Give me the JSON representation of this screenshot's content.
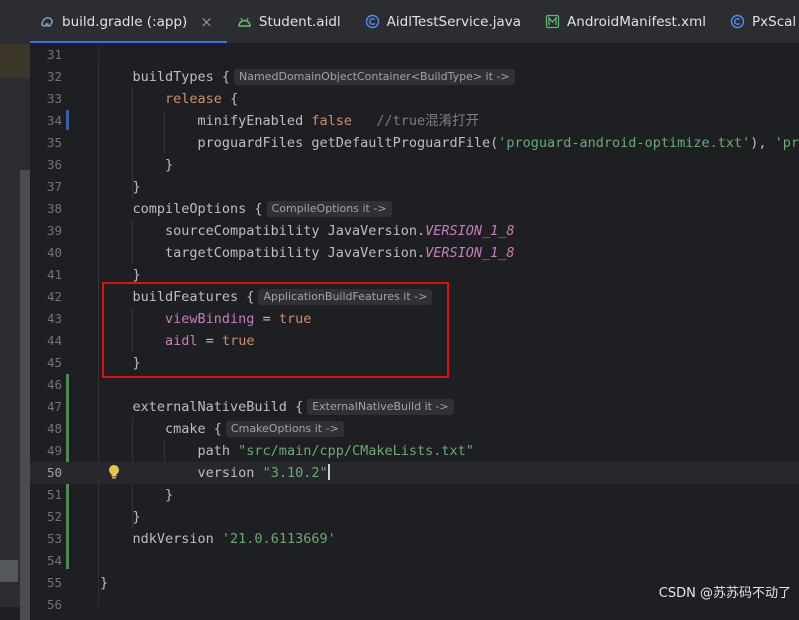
{
  "tabs": [
    {
      "label": "build.gradle (:app)",
      "icon": "gradle-icon",
      "active": true,
      "closable": true
    },
    {
      "label": "Student.aidl",
      "icon": "android-icon",
      "active": false
    },
    {
      "label": "AidlTestService.java",
      "icon": "class-icon",
      "active": false
    },
    {
      "label": "AndroidManifest.xml",
      "icon": "manifest-icon",
      "active": false
    },
    {
      "label": "PxScal",
      "icon": "class-icon",
      "active": false
    }
  ],
  "close_glyph": "×",
  "lines": [
    {
      "n": "31",
      "parts": []
    },
    {
      "n": "32",
      "parts": [
        {
          "t": "    buildTypes {",
          "c": ""
        }
      ],
      "hint": "NamedDomainObjectContainer<BuildType> it ->"
    },
    {
      "n": "33",
      "parts": [
        {
          "t": "        ",
          "c": ""
        },
        {
          "t": "release",
          "c": "kw"
        },
        {
          "t": " {",
          "c": ""
        }
      ]
    },
    {
      "n": "34",
      "parts": [
        {
          "t": "            minifyEnabled ",
          "c": ""
        },
        {
          "t": "false",
          "c": "kw"
        },
        {
          "t": "   //true混淆打开",
          "c": "cmt"
        }
      ]
    },
    {
      "n": "35",
      "parts": [
        {
          "t": "            proguardFiles getDefaultProguardFile(",
          "c": ""
        },
        {
          "t": "'proguard-android-optimize.txt'",
          "c": "str"
        },
        {
          "t": "), ",
          "c": ""
        },
        {
          "t": "'prog",
          "c": "str"
        }
      ]
    },
    {
      "n": "36",
      "parts": [
        {
          "t": "        }",
          "c": ""
        }
      ]
    },
    {
      "n": "37",
      "parts": [
        {
          "t": "    }",
          "c": ""
        }
      ]
    },
    {
      "n": "38",
      "parts": [
        {
          "t": "    compileOptions {",
          "c": ""
        }
      ],
      "hint": "CompileOptions it ->"
    },
    {
      "n": "39",
      "parts": [
        {
          "t": "        sourceCompatibility JavaVersion.",
          "c": ""
        },
        {
          "t": "VERSION_1_8",
          "c": "const"
        }
      ]
    },
    {
      "n": "40",
      "parts": [
        {
          "t": "        targetCompatibility JavaVersion.",
          "c": ""
        },
        {
          "t": "VERSION_1_8",
          "c": "const"
        }
      ]
    },
    {
      "n": "41",
      "parts": [
        {
          "t": "    }",
          "c": ""
        }
      ]
    },
    {
      "n": "42",
      "parts": [
        {
          "t": "    buildFeatures {",
          "c": ""
        }
      ],
      "hint": "ApplicationBuildFeatures it ->"
    },
    {
      "n": "43",
      "parts": [
        {
          "t": "        ",
          "c": ""
        },
        {
          "t": "viewBinding",
          "c": "prop"
        },
        {
          "t": " = ",
          "c": ""
        },
        {
          "t": "true",
          "c": "kw"
        }
      ]
    },
    {
      "n": "44",
      "parts": [
        {
          "t": "        ",
          "c": ""
        },
        {
          "t": "aidl",
          "c": "prop"
        },
        {
          "t": " = ",
          "c": ""
        },
        {
          "t": "true",
          "c": "kw"
        }
      ]
    },
    {
      "n": "45",
      "parts": [
        {
          "t": "    }",
          "c": ""
        }
      ]
    },
    {
      "n": "46",
      "parts": []
    },
    {
      "n": "47",
      "parts": [
        {
          "t": "    externalNativeBuild {",
          "c": ""
        }
      ],
      "hint": "ExternalNativeBuild it ->"
    },
    {
      "n": "48",
      "parts": [
        {
          "t": "        cmake {",
          "c": ""
        }
      ],
      "hint": "CmakeOptions it ->"
    },
    {
      "n": "49",
      "parts": [
        {
          "t": "            path ",
          "c": ""
        },
        {
          "t": "\"src/main/cpp/CMakeLists.txt\"",
          "c": "str"
        }
      ]
    },
    {
      "n": "50",
      "parts": [
        {
          "t": "            version ",
          "c": ""
        },
        {
          "t": "\"3.10.2\"",
          "c": "str"
        }
      ],
      "current": true,
      "caret": true
    },
    {
      "n": "51",
      "parts": [
        {
          "t": "        }",
          "c": ""
        }
      ]
    },
    {
      "n": "52",
      "parts": [
        {
          "t": "    }",
          "c": ""
        }
      ]
    },
    {
      "n": "53",
      "parts": [
        {
          "t": "    ndkVersion ",
          "c": ""
        },
        {
          "t": "'21.0.6113669'",
          "c": "str"
        }
      ]
    },
    {
      "n": "54",
      "parts": []
    },
    {
      "n": "55",
      "parts": [
        {
          "t": "}",
          "c": ""
        }
      ]
    },
    {
      "n": "56",
      "parts": []
    }
  ],
  "watermark": "CSDN @苏苏码不动了"
}
